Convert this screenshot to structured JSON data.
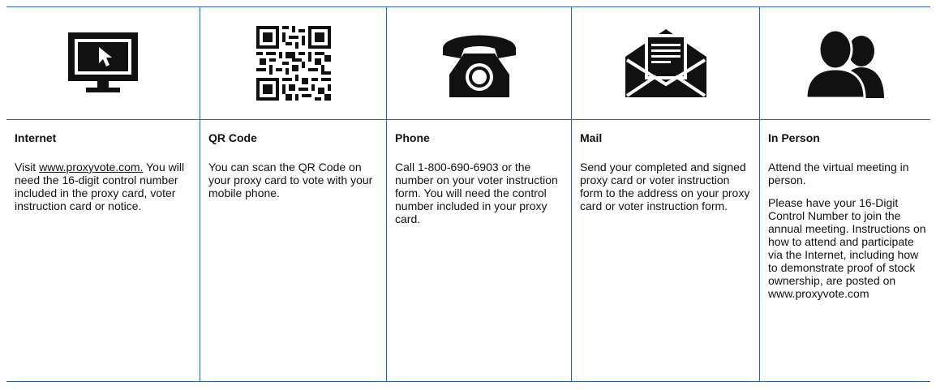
{
  "methods": [
    {
      "title": "Internet",
      "icon": "computer-monitor-icon",
      "text_prefix": "Visit ",
      "link": "www.proxyvote.com.",
      "text_suffix": " You will need the 16-digit control number included in the proxy card, voter instruction card or notice."
    },
    {
      "title": "QR Code",
      "icon": "qr-code-icon",
      "text": "You can scan the QR Code on your proxy card to vote with your mobile phone."
    },
    {
      "title": "Phone",
      "icon": "telephone-icon",
      "text": "Call 1-800-690-6903 or the number on your voter instruction form. You will need the control number included in your proxy card."
    },
    {
      "title": "Mail",
      "icon": "envelope-icon",
      "text": "Send your completed and signed proxy card or voter instruction form to the address on your proxy card or voter instruction form."
    },
    {
      "title": "In Person",
      "icon": "people-icon",
      "text": "Attend the virtual meeting in person.",
      "text2": "Please have your 16-Digit Control Number to join the annual meeting. Instructions on how to attend and participate via the Internet, including how to demonstrate proof of stock ownership, are posted on www.proxyvote.com"
    }
  ]
}
